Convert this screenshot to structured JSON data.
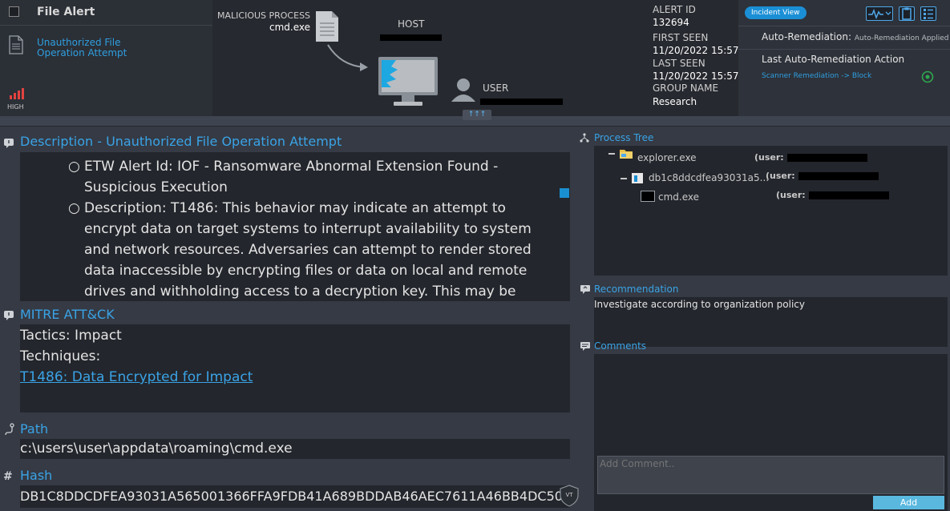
{
  "header": {
    "title": "File Alert",
    "alert_link": "Unauthorized File Operation Attempt",
    "severity": "HIGH",
    "malicious_process_label": "MALICIOUS PROCESS",
    "malicious_process_value": "cmd.exe",
    "host_label": "HOST",
    "user_label": "USER",
    "alert_id_label": "ALERT ID",
    "alert_id": "132694",
    "first_seen_label": "FIRST SEEN",
    "first_seen": "11/20/2022 15:57",
    "last_seen_label": "LAST SEEN",
    "last_seen": "11/20/2022 15:57",
    "group_name_label": "GROUP NAME",
    "group_name": "Research",
    "incident_view": "Incident View",
    "auto_remediation_label": "Auto-Remediation:",
    "auto_remediation_value": "Auto-Remediation Applied",
    "last_action_label": "Last Auto-Remediation Action",
    "last_action_value": "Scanner Remediation -> Block",
    "expand_arrows": "↑↑↑"
  },
  "description": {
    "title": "Description - Unauthorized File Operation Attempt",
    "bullets": [
      "ETW Alert Id: IOF - Ransomware Abnormal Extension Found - Suspicious Execution",
      "Description: T1486: This behavior may indicate an attempt to encrypt data on target systems to interrupt availability to system and network resources. Adversaries can attempt to render stored data inaccessible by encrypting files or data on local and remote drives and withholding access to a decryption key. This may be done in order to extract"
    ]
  },
  "mitre": {
    "title": "MITRE ATT&CK",
    "tactics": "Tactics: Impact",
    "techniques": "Techniques:",
    "technique_link": "T1486: Data Encrypted for Impact"
  },
  "path": {
    "title": "Path",
    "value": "c:\\users\\user\\appdata\\roaming\\cmd.exe"
  },
  "hash": {
    "title": "Hash",
    "value": "DB1C8DDCDFEA93031A565001366FFA9FDB41A689BDDAB46AEC7611A46BB4DC50",
    "vt_label": "VT"
  },
  "process_tree": {
    "title": "Process Tree",
    "nodes": [
      {
        "name": "explorer.exe",
        "user_label": "(user:"
      },
      {
        "name": "db1c8ddcdfea93031a5...",
        "user_label": "(user:"
      },
      {
        "name": "cmd.exe",
        "user_label": "(user:"
      }
    ]
  },
  "recommendation": {
    "title": "Recommendation",
    "text": "Investigate according to organization policy"
  },
  "comments": {
    "title": "Comments",
    "placeholder": "Add Comment..",
    "add_button": "Add"
  },
  "colors": {
    "accent": "#3aa3e6",
    "severity": "#e2433f",
    "background": "#353a44",
    "panel": "#23262c"
  }
}
